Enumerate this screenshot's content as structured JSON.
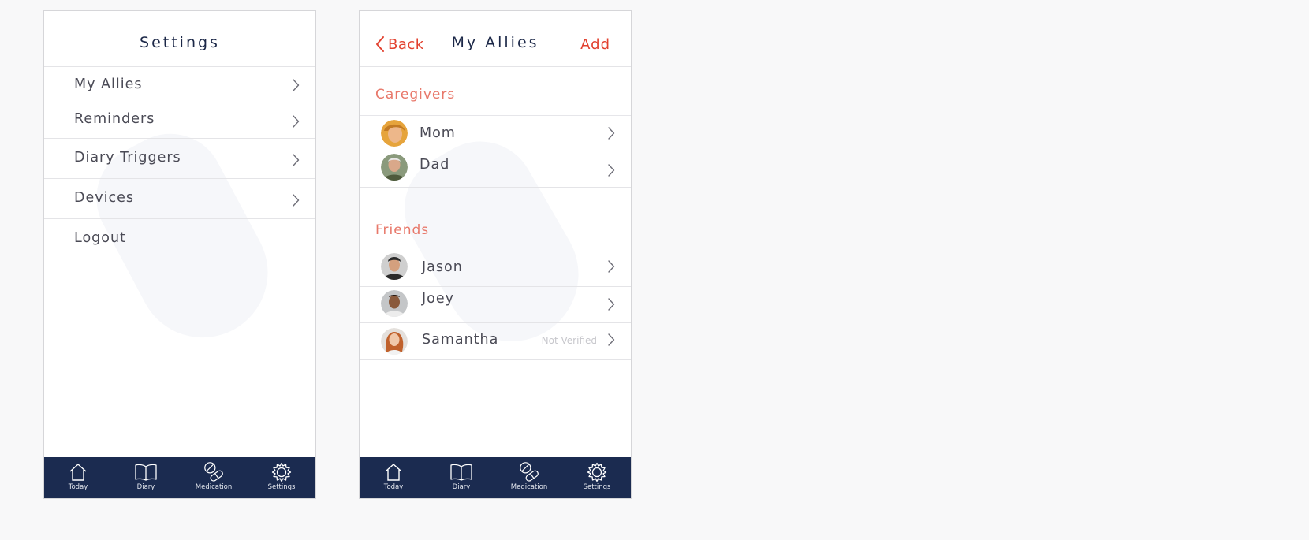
{
  "settings_screen": {
    "title": "Settings",
    "items": [
      {
        "label": "My Allies"
      },
      {
        "label": "Reminders"
      },
      {
        "label": "Diary Triggers"
      },
      {
        "label": "Devices"
      },
      {
        "label": "Logout"
      }
    ]
  },
  "allies_screen": {
    "back_label": "Back",
    "title": "My Allies",
    "add_label": "Add",
    "caregivers_header": "Caregivers",
    "caregivers": [
      {
        "name": "Mom",
        "avatar": "mom-avatar"
      },
      {
        "name": "Dad",
        "avatar": "dad-avatar"
      }
    ],
    "friends_header": "Friends",
    "friends": [
      {
        "name": "Jason",
        "avatar": "jason-avatar"
      },
      {
        "name": "Joey",
        "avatar": "joey-avatar"
      },
      {
        "name": "Samantha",
        "avatar": "samantha-avatar",
        "status": "Not Verified"
      }
    ]
  },
  "tabbar": {
    "tabs": [
      {
        "label": "Today",
        "icon": "home-icon"
      },
      {
        "label": "Diary",
        "icon": "book-icon"
      },
      {
        "label": "Medication",
        "icon": "pill-icon"
      },
      {
        "label": "Settings",
        "icon": "gear-icon"
      }
    ]
  },
  "colors": {
    "accent": "#e2412f",
    "section_header": "#e8786a",
    "navy": "#1b2b50",
    "title": "#1c2848",
    "text": "#4a4a55"
  }
}
